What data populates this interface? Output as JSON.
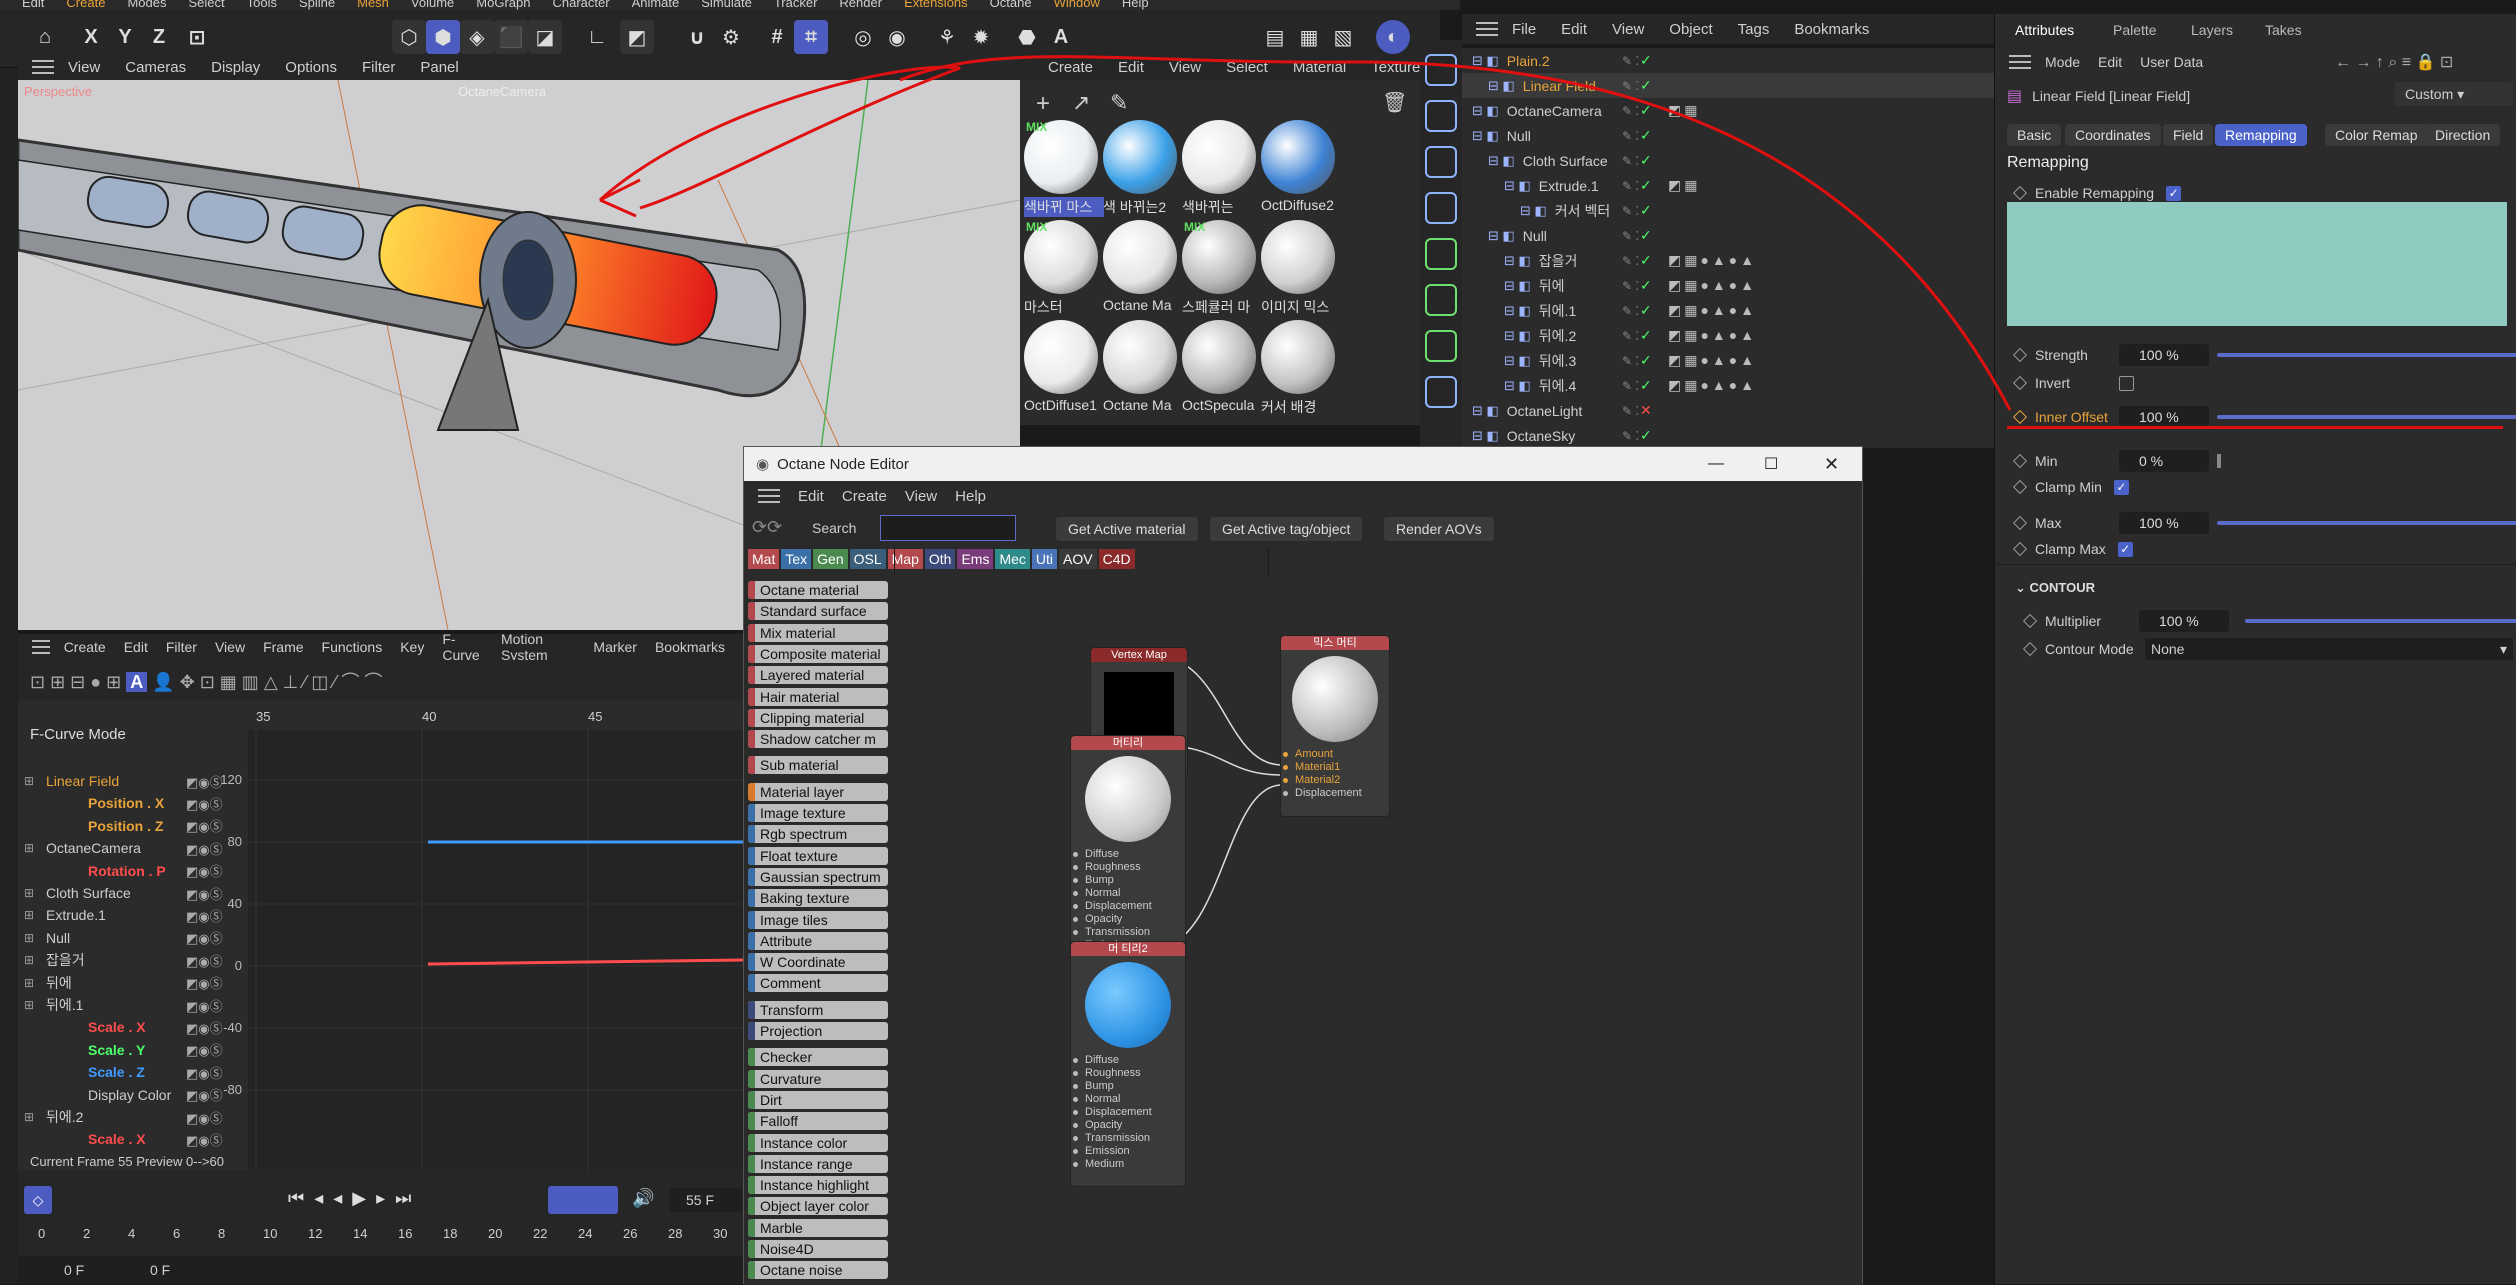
{
  "top_menu": {
    "items": [
      "Edit",
      "Create",
      "Modes",
      "Select",
      "Tools",
      "Spline",
      "Mesh",
      "Volume",
      "MoGraph",
      "Character",
      "Animate",
      "Simulate",
      "Tracker",
      "Render",
      "Extensions",
      "Octane",
      "Window",
      "Help"
    ],
    "highlighted": [
      "Create",
      "Mesh",
      "Extensions",
      "Window"
    ]
  },
  "axes": {
    "x": "X",
    "y": "Y",
    "z": "Z"
  },
  "viewport_menu": {
    "items": [
      "View",
      "Cameras",
      "Display",
      "Options",
      "Filter",
      "Panel"
    ],
    "label_perspective": "Perspective",
    "label_camera": "OctaneCamera"
  },
  "material_menu": {
    "items": [
      "Create",
      "Edit",
      "View",
      "Select",
      "Material",
      "Texture"
    ]
  },
  "materials": [
    {
      "label": "색바뀌 마스",
      "color": "#e9eef2",
      "mix": true
    },
    {
      "label": "색 바뀌는2",
      "color": "#3aa0e8",
      "mix": false
    },
    {
      "label": "색바뀌는",
      "color": "#e8e8e8",
      "mix": false
    },
    {
      "label": "OctDiffuse2",
      "color": "#3d82d4",
      "mix": false
    },
    {
      "label": "마스터",
      "color": "#dcdcdc",
      "mix": true
    },
    {
      "label": "Octane Ma",
      "color": "#e4e4e4",
      "mix": false
    },
    {
      "label": "스페큘러 마",
      "color": "#b8b8b8",
      "mix": true
    },
    {
      "label": "이미지 믹스",
      "color": "#d0d0d0",
      "mix": false
    },
    {
      "label": "OctDiffuse1",
      "color": "#eaeaea",
      "mix": false
    },
    {
      "label": "Octane Ma",
      "color": "#d8d8d8",
      "mix": false
    },
    {
      "label": "OctSpecula",
      "color": "#bdbdbd",
      "mix": false
    },
    {
      "label": "커서 배경",
      "color": "#c4c4c4",
      "mix": false
    }
  ],
  "object_menu": {
    "items": [
      "File",
      "Edit",
      "View",
      "Object",
      "Tags",
      "Bookmarks"
    ]
  },
  "objects": [
    {
      "name": "Plain.2",
      "indent": 0,
      "color": "#e8a33a"
    },
    {
      "name": "Linear Field",
      "indent": 1,
      "color": "#e8a33a"
    },
    {
      "name": "OctaneCamera",
      "indent": 0,
      "color": "#cfcfcf"
    },
    {
      "name": "Null",
      "indent": 0,
      "color": "#cfcfcf"
    },
    {
      "name": "Cloth Surface",
      "indent": 1,
      "color": "#cfcfcf"
    },
    {
      "name": "Extrude.1",
      "indent": 2,
      "color": "#cfcfcf"
    },
    {
      "name": "커서 벡터",
      "indent": 3,
      "color": "#cfcfcf"
    },
    {
      "name": "Null",
      "indent": 1,
      "color": "#cfcfcf"
    },
    {
      "name": "잡을거",
      "indent": 2,
      "color": "#cfcfcf"
    },
    {
      "name": "뒤에",
      "indent": 2,
      "color": "#cfcfcf"
    },
    {
      "name": "뒤에.1",
      "indent": 2,
      "color": "#cfcfcf"
    },
    {
      "name": "뒤에.2",
      "indent": 2,
      "color": "#cfcfcf"
    },
    {
      "name": "뒤에.3",
      "indent": 2,
      "color": "#cfcfcf"
    },
    {
      "name": "뒤에.4",
      "indent": 2,
      "color": "#cfcfcf"
    },
    {
      "name": "OctaneLight",
      "indent": 0,
      "color": "#cfcfcf"
    },
    {
      "name": "OctaneSky",
      "indent": 0,
      "color": "#cfcfcf"
    }
  ],
  "attributes": {
    "tabs": [
      "Attributes",
      "Palette",
      "Layers",
      "Takes"
    ],
    "menu": [
      "Mode",
      "Edit",
      "User Data"
    ],
    "object_title": "Linear Field [Linear Field]",
    "preset": "Custom",
    "subtabs": [
      "Basic",
      "Coordinates",
      "Field",
      "Remapping",
      "Color Remap",
      "Direction"
    ],
    "active_subtab": "Remapping",
    "section": "Remapping",
    "enable_remapping": "Enable Remapping",
    "strength_label": "Strength",
    "strength": "100 %",
    "invert_label": "Invert",
    "inner_offset_label": "Inner Offset",
    "inner_offset": "100 %",
    "min_label": "Min",
    "min": "0 %",
    "clamp_min_label": "Clamp Min",
    "max_label": "Max",
    "max": "100 %",
    "clamp_max_label": "Clamp Max",
    "contour_section": "CONTOUR",
    "multiplier_label": "Multiplier",
    "multiplier": "100 %",
    "contour_mode_label": "Contour Mode",
    "contour_mode": "None"
  },
  "timeline": {
    "menu": [
      "Create",
      "Edit",
      "Filter",
      "View",
      "Frame",
      "Functions",
      "Key",
      "F-Curve",
      "Motion System",
      "Marker",
      "Bookmarks"
    ],
    "mode_label": "F-Curve Mode",
    "ruler": [
      "35",
      "40",
      "45"
    ],
    "yticks": [
      "120",
      "80",
      "40",
      "0",
      "-40",
      "-80"
    ],
    "tracks": [
      {
        "name": "Linear Field",
        "color": "#e8a33a",
        "indent": 0
      },
      {
        "name": "Position . X",
        "color": "#e8a33a",
        "indent": 1
      },
      {
        "name": "Position . Z",
        "color": "#e8a33a",
        "indent": 1
      },
      {
        "name": "OctaneCamera",
        "color": "#cfcfcf",
        "indent": 0
      },
      {
        "name": "Rotation . P",
        "color": "#ff4d4d",
        "indent": 1
      },
      {
        "name": "Cloth Surface",
        "color": "#cfcfcf",
        "indent": 0
      },
      {
        "name": "Extrude.1",
        "color": "#cfcfcf",
        "indent": 0
      },
      {
        "name": "Null",
        "color": "#cfcfcf",
        "indent": 0
      },
      {
        "name": "잡을거",
        "color": "#cfcfcf",
        "indent": 0
      },
      {
        "name": "뒤에",
        "color": "#cfcfcf",
        "indent": 0
      },
      {
        "name": "뒤에.1",
        "color": "#cfcfcf",
        "indent": 0
      },
      {
        "name": "Scale . X",
        "color": "#ff4d4d",
        "indent": 1
      },
      {
        "name": "Scale . Y",
        "color": "#4dff6a",
        "indent": 1
      },
      {
        "name": "Scale . Z",
        "color": "#3f9bff",
        "indent": 1
      },
      {
        "name": "Display Color",
        "color": "#cfcfcf",
        "indent": 1
      },
      {
        "name": "뒤에.2",
        "color": "#cfcfcf",
        "indent": 0
      },
      {
        "name": "Scale . X",
        "color": "#ff4d4d",
        "indent": 1
      }
    ],
    "status": "Current Frame  55  Preview  0-->60",
    "frame_field": "55 F",
    "scale": [
      "0",
      "2",
      "4",
      "6",
      "8",
      "10",
      "12",
      "14",
      "16",
      "18",
      "20",
      "22",
      "24",
      "26",
      "28",
      "30"
    ],
    "bottom_left": "0 F",
    "bottom_right": "0 F"
  },
  "node_editor": {
    "title": "Octane Node Editor",
    "menu": [
      "Edit",
      "Create",
      "View",
      "Help"
    ],
    "search_label": "Search",
    "search_placeholder": "",
    "buttons": [
      "Get Active material",
      "Get Active tag/object",
      "Render AOVs"
    ],
    "categories": [
      {
        "label": "Mat",
        "color": "#b3484d"
      },
      {
        "label": "Tex",
        "color": "#3a6fa8"
      },
      {
        "label": "Gen",
        "color": "#4a8a4f"
      },
      {
        "label": "OSL",
        "color": "#3b5f7a"
      },
      {
        "label": "Map",
        "color": "#b3484d"
      },
      {
        "label": "Oth",
        "color": "#3b4a7a"
      },
      {
        "label": "Ems",
        "color": "#7a3b7a"
      },
      {
        "label": "Mec",
        "color": "#2f8a8a"
      },
      {
        "label": "Uti",
        "color": "#4a73b8"
      },
      {
        "label": "AOV",
        "color": "#3a3a3a"
      },
      {
        "label": "C4D",
        "color": "#8a2a2a"
      }
    ],
    "node_list": [
      {
        "label": "Octane material",
        "c": "#b3484d"
      },
      {
        "label": "Standard surface",
        "c": "#b3484d"
      },
      {
        "label": "Mix material",
        "c": "#b3484d"
      },
      {
        "label": "Composite material",
        "c": "#b3484d"
      },
      {
        "label": "Layered material",
        "c": "#b3484d"
      },
      {
        "label": "Hair material",
        "c": "#b3484d"
      },
      {
        "label": "Clipping material",
        "c": "#b3484d"
      },
      {
        "label": "Shadow catcher m",
        "c": "#b3484d"
      },
      {
        "label": "Sub material",
        "c": "#b3484d"
      },
      {
        "label": "Material layer",
        "c": "#d87a2a"
      },
      {
        "label": "Image texture",
        "c": "#3a6fa8"
      },
      {
        "label": "Rgb spectrum",
        "c": "#3a6fa8"
      },
      {
        "label": "Float texture",
        "c": "#3a6fa8"
      },
      {
        "label": "Gaussian spectrum",
        "c": "#3a6fa8"
      },
      {
        "label": "Baking texture",
        "c": "#3a6fa8"
      },
      {
        "label": "Image tiles",
        "c": "#3a6fa8"
      },
      {
        "label": "Attribute",
        "c": "#3a6fa8"
      },
      {
        "label": "W Coordinate",
        "c": "#3a6fa8"
      },
      {
        "label": "Comment",
        "c": "#3a6fa8"
      },
      {
        "label": "Transform",
        "c": "#3b4a7a"
      },
      {
        "label": "Projection",
        "c": "#3b4a7a"
      },
      {
        "label": "Checker",
        "c": "#4a8a4f"
      },
      {
        "label": "Curvature",
        "c": "#4a8a4f"
      },
      {
        "label": "Dirt",
        "c": "#4a8a4f"
      },
      {
        "label": "Falloff",
        "c": "#4a8a4f"
      },
      {
        "label": "Instance color",
        "c": "#4a8a4f"
      },
      {
        "label": "Instance range",
        "c": "#4a8a4f"
      },
      {
        "label": "Instance highlight",
        "c": "#4a8a4f"
      },
      {
        "label": "Object layer color",
        "c": "#4a8a4f"
      },
      {
        "label": "Marble",
        "c": "#4a8a4f"
      },
      {
        "label": "Noise4D",
        "c": "#4a8a4f"
      },
      {
        "label": "Octane noise",
        "c": "#4a8a4f"
      }
    ],
    "vertex_node": "Vertex Map",
    "mix_node": "믹스 머티",
    "mat1_node": "머티리",
    "mat2_node": "머 티리2",
    "mix_pins": [
      "Amount",
      "Material1",
      "Material2",
      "Displacement"
    ],
    "mat_pins": [
      "Diffuse",
      "Roughness",
      "Bump",
      "Normal",
      "Displacement",
      "Opacity",
      "Transmission",
      "Emission",
      "Medium"
    ]
  }
}
